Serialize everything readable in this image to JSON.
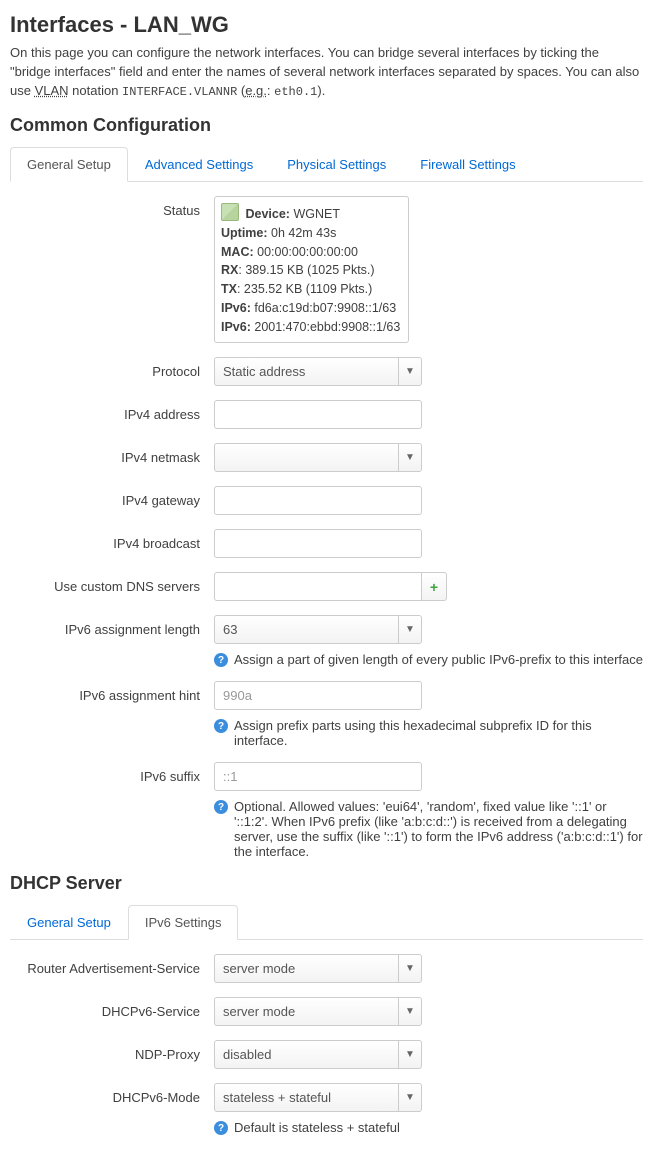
{
  "page_title": "Interfaces - LAN_WG",
  "intro_prefix": "On this page you can configure the network interfaces. You can bridge several interfaces by ticking the \"bridge interfaces\" field and enter the names of several network interfaces separated by spaces. You can also use ",
  "vlan_abbr": "VLAN",
  "intro_mid": " notation ",
  "intro_code1": "INTERFACE.VLANNR",
  "intro_paren_open": " (",
  "eg_abbr": "e.g.",
  "intro_colon": ": ",
  "intro_code2": "eth0.1",
  "intro_end": ").",
  "common_heading": "Common Configuration",
  "tabs_common": [
    "General Setup",
    "Advanced Settings",
    "Physical Settings",
    "Firewall Settings"
  ],
  "fields": {
    "status": {
      "label": "Status"
    },
    "protocol": {
      "label": "Protocol",
      "value": "Static address"
    },
    "ipv4_addr": {
      "label": "IPv4 address",
      "value": ""
    },
    "ipv4_mask": {
      "label": "IPv4 netmask",
      "value": ""
    },
    "ipv4_gw": {
      "label": "IPv4 gateway",
      "value": ""
    },
    "ipv4_bcast": {
      "label": "IPv4 broadcast",
      "value": ""
    },
    "dns": {
      "label": "Use custom DNS servers",
      "value": ""
    },
    "ip6len": {
      "label": "IPv6 assignment length",
      "value": "63",
      "hint": "Assign a part of given length of every public IPv6-prefix to this interface"
    },
    "ip6hint": {
      "label": "IPv6 assignment hint",
      "placeholder": "990a",
      "hint": "Assign prefix parts using this hexadecimal subprefix ID for this interface."
    },
    "ip6suffix": {
      "label": "IPv6 suffix",
      "placeholder": "::1",
      "hint": "Optional. Allowed values: 'eui64', 'random', fixed value like '::1' or '::1:2'. When IPv6 prefix (like 'a:b:c:d::') is received from a delegating server, use the suffix (like '::1') to form the IPv6 address ('a:b:c:d::1') for the interface."
    }
  },
  "status": {
    "device_l": "Device:",
    "device_v": " WGNET",
    "uptime_l": "Uptime:",
    "uptime_v": " 0h 42m 43s",
    "mac_l": "MAC:",
    "mac_v": " 00:00:00:00:00:00",
    "rx_l": "RX",
    "rx_v": ": 389.15 KB (1025 Pkts.)",
    "tx_l": "TX",
    "tx_v": ": 235.52 KB (1109 Pkts.)",
    "ipv6a_l": "IPv6:",
    "ipv6a_v": " fd6a:c19d:b07:9908::1/63",
    "ipv6b_l": "IPv6:",
    "ipv6b_v": " 2001:470:ebbd:9908::1/63"
  },
  "dhcp_heading": "DHCP Server",
  "tabs_dhcp": [
    "General Setup",
    "IPv6 Settings"
  ],
  "dhcp": {
    "ra": {
      "label": "Router Advertisement-Service",
      "value": "server mode"
    },
    "d6": {
      "label": "DHCPv6-Service",
      "value": "server mode"
    },
    "ndp": {
      "label": "NDP-Proxy",
      "value": "disabled"
    },
    "mode": {
      "label": "DHCPv6-Mode",
      "value": "stateless + stateful",
      "hint": "Default is stateless + stateful"
    }
  }
}
